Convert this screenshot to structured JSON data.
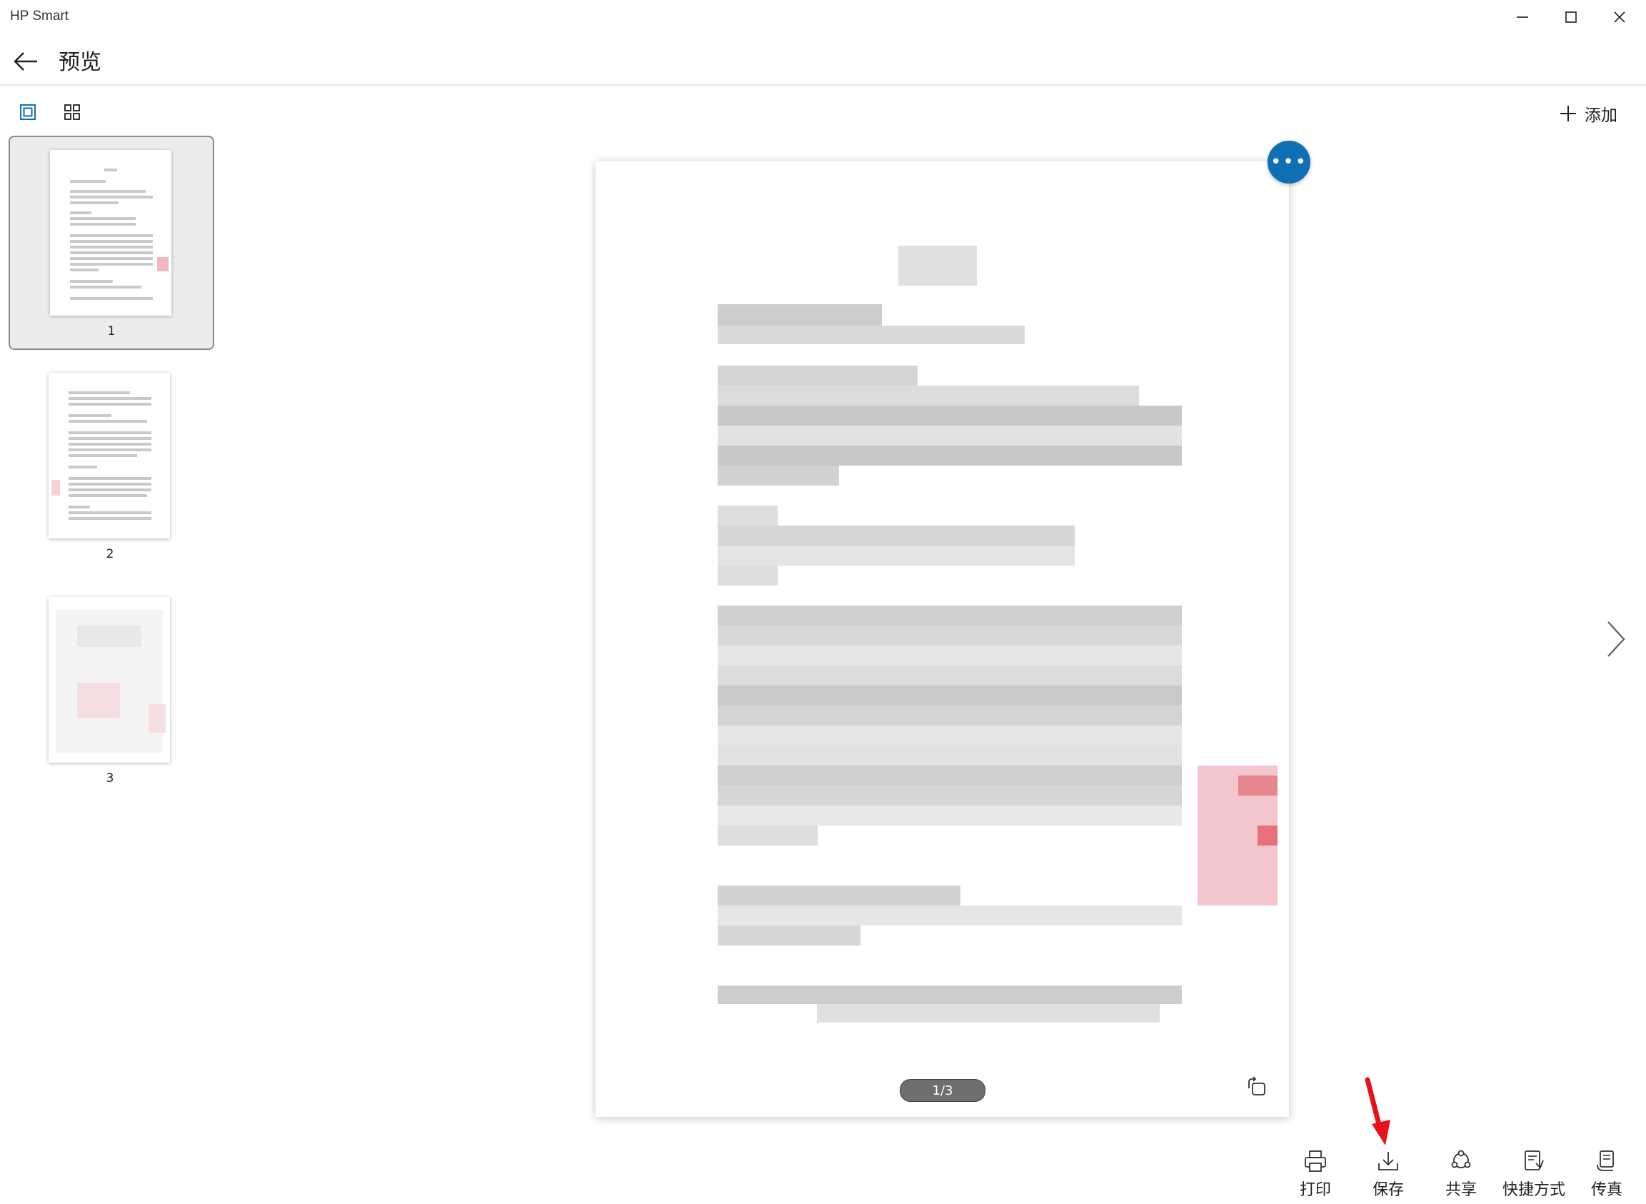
{
  "window": {
    "app_title": "HP Smart"
  },
  "header": {
    "title": "预览"
  },
  "toolbar": {
    "add_label": "添加"
  },
  "thumbnails": [
    {
      "number": "1",
      "selected": true
    },
    {
      "number": "2",
      "selected": false
    },
    {
      "number": "3",
      "selected": false
    }
  ],
  "preview": {
    "page_indicator": "1/3"
  },
  "actions": [
    {
      "label": "打印",
      "icon": "printer-icon"
    },
    {
      "label": "保存",
      "icon": "save-download-icon"
    },
    {
      "label": "共享",
      "icon": "share-icon"
    },
    {
      "label": "快捷方式",
      "icon": "shortcut-icon"
    },
    {
      "label": "传真",
      "icon": "fax-icon"
    }
  ],
  "colors": {
    "accent": "#0f6fb3",
    "annotation_arrow": "#e8101a",
    "selected_thumb_bg": "#ececec"
  }
}
